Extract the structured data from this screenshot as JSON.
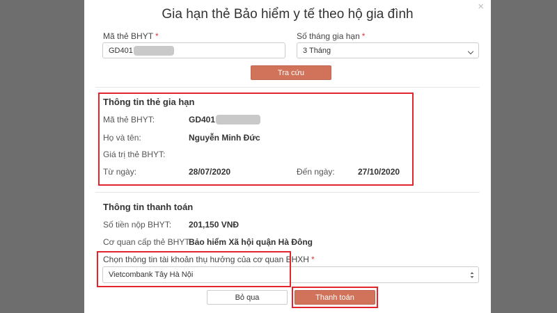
{
  "dialog": {
    "title": "Gia hạn thẻ Bảo hiểm y tế theo hộ gia đình",
    "close_glyph": "×"
  },
  "form": {
    "card_number_label": "Mã thẻ BHYT",
    "card_number_value": "GD401",
    "months_label": "Số tháng gia hạn",
    "months_value": "3 Tháng",
    "required_mark": "*",
    "lookup_button": "Tra cứu"
  },
  "renewal_info": {
    "title": "Thông tin thẻ gia hạn",
    "card_number_label": "Mã thẻ BHYT:",
    "card_number_value": "GD401",
    "name_label": "Họ và tên:",
    "name_value": "Nguyễn Minh Đức",
    "validity_label": "Giá trị thẻ BHYT:",
    "from_label": "Từ ngày:",
    "from_value": "28/07/2020",
    "to_label": "Đến ngày:",
    "to_value": "27/10/2020"
  },
  "payment_info": {
    "title": "Thông tin thanh toán",
    "amount_label": "Số tiền nộp BHYT:",
    "amount_value": "201,150 VNĐ",
    "agency_label": "Cơ quan cấp thẻ BHYT:",
    "agency_value": "Bảo hiểm Xã hội quận Hà Đông",
    "account_label": "Chọn thông tin tài khoản thụ hưởng của cơ quan BHXH",
    "account_value": "Vietcombank Tây Hà Nội"
  },
  "actions": {
    "skip_button": "Bỏ qua",
    "pay_button": "Thanh toán"
  },
  "colors": {
    "accent": "#d0735a",
    "highlight": "#e3242b",
    "backdrop": "#6e6e6e"
  }
}
